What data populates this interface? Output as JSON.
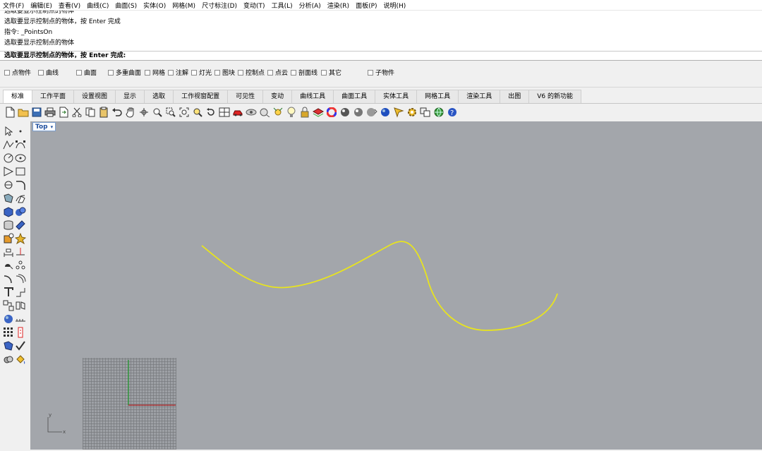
{
  "menu": [
    "文件(F)",
    "编辑(E)",
    "查看(V)",
    "曲线(C)",
    "曲面(S)",
    "实体(O)",
    "网格(M)",
    "尺寸标注(D)",
    "变动(T)",
    "工具(L)",
    "分析(A)",
    "渲染(R)",
    "面板(P)",
    "说明(H)"
  ],
  "history": {
    "line0": "选取要显示控制点的物体",
    "line1": "选取要显示控制点的物体，按 Enter 完成",
    "line2": "指令: _PointsOn",
    "line3": "选取要显示控制点的物体"
  },
  "prompt": "选取要显示控制点的物体，按 Enter 完成:",
  "osnap": [
    "点物件",
    "曲线",
    "曲面",
    "多重曲面",
    "网格",
    "注解",
    "灯光",
    "图块",
    "控制点",
    "点云",
    "剖面线",
    "其它",
    "子物件"
  ],
  "tabs": [
    "标准",
    "工作平面",
    "设置视图",
    "显示",
    "选取",
    "工作视窗配置",
    "可见性",
    "变动",
    "曲线工具",
    "曲面工具",
    "实体工具",
    "网格工具",
    "渲染工具",
    "出图",
    "V6 的新功能"
  ],
  "viewport": {
    "title": "Top",
    "axis_x": "x",
    "axis_y": "y",
    "curve_color": "#e8e41e",
    "background": "#a3a6ab"
  }
}
